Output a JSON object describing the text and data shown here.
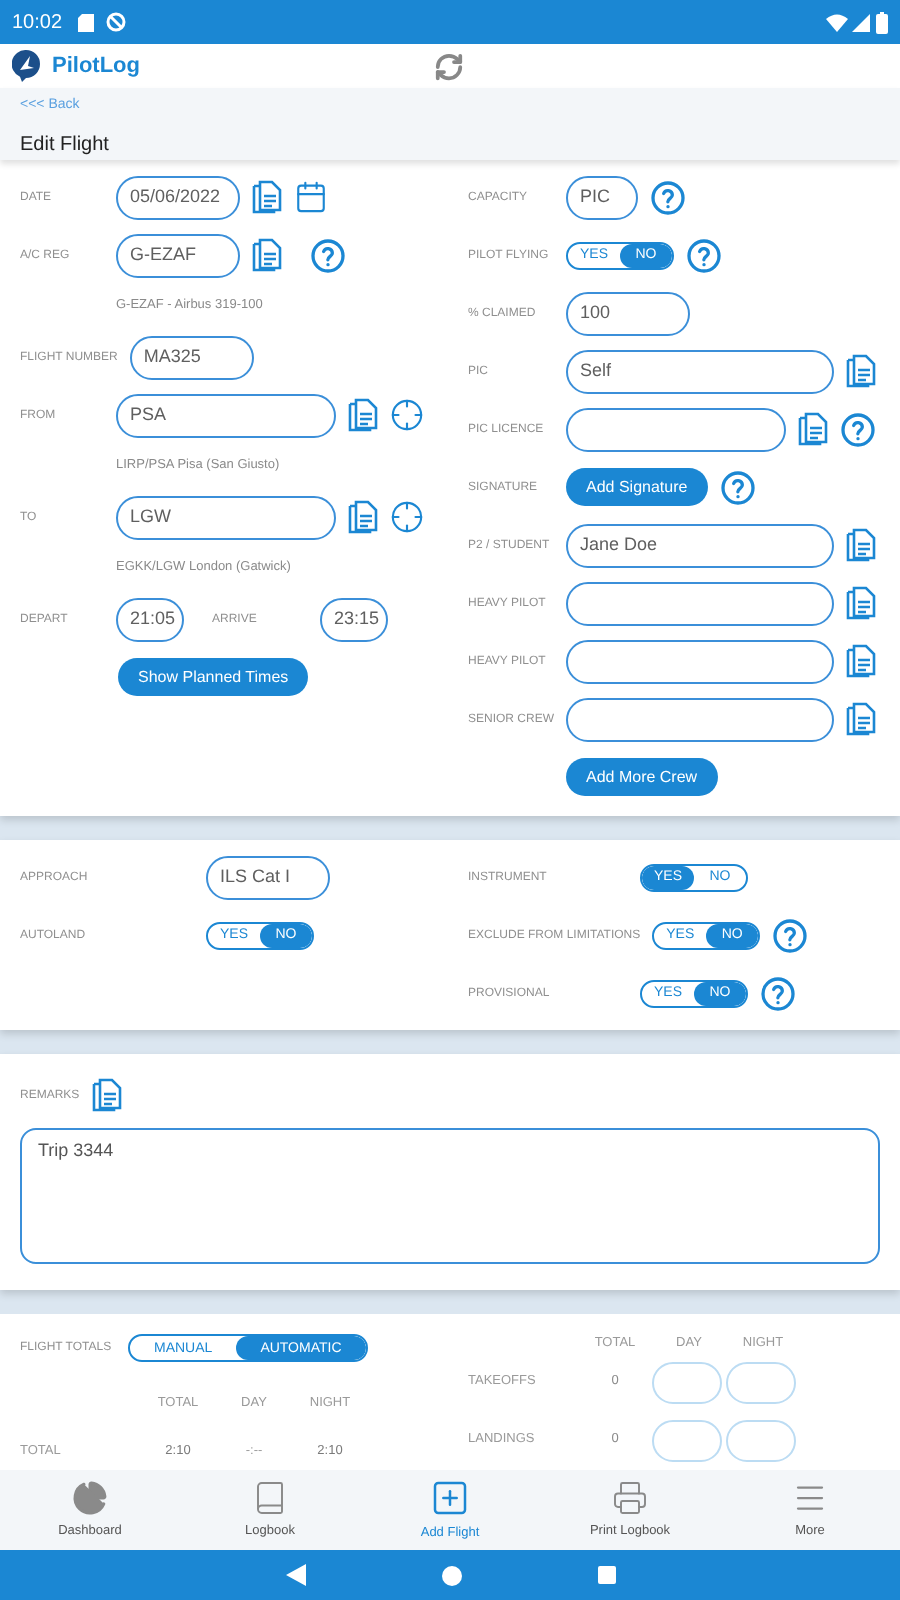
{
  "status_bar": {
    "time": "10:02"
  },
  "app": {
    "name": "PilotLog"
  },
  "back_link": "<<< Back",
  "page_title": "Edit Flight",
  "flight": {
    "left": [
      {
        "kind": "date",
        "label": "DATE",
        "value": "05/06/2022"
      },
      {
        "kind": "reg",
        "label": "A/C REG",
        "value": "G-EZAF",
        "note": "G-EZAF - Airbus 319-100"
      },
      {
        "kind": "short",
        "label": "FLIGHT NUMBER",
        "value": "MA325"
      },
      {
        "kind": "place",
        "label": "FROM",
        "value": "PSA",
        "note": "LIRP/PSA Pisa (San Giusto)"
      },
      {
        "kind": "place",
        "label": "TO",
        "value": "LGW",
        "note": "EGKK/LGW London (Gatwick)"
      },
      {
        "kind": "times",
        "label": "DEPART",
        "value": "21:05",
        "label2": "ARRIVE",
        "value2": "23:15"
      },
      {
        "kind": "button",
        "label": "Show Planned Times"
      }
    ],
    "right": [
      {
        "kind": "short_help",
        "label": "CAPACITY",
        "value": "PIC"
      },
      {
        "kind": "toggle_help",
        "label": "PILOT FLYING",
        "options": [
          {
            "label": "YES",
            "selected": false
          },
          {
            "label": "NO",
            "selected": true
          }
        ]
      },
      {
        "kind": "short",
        "label": "% CLAIMED",
        "value": "100"
      },
      {
        "kind": "wide",
        "label": "PIC",
        "value": "Self"
      },
      {
        "kind": "wide_help",
        "label": "PIC LICENCE"
      },
      {
        "kind": "button_help",
        "label": "SIGNATURE",
        "button": "Add Signature"
      },
      {
        "kind": "wide",
        "label": "P2 / STUDENT",
        "value": "Jane Doe"
      },
      {
        "kind": "wide",
        "label": "HEAVY PILOT"
      },
      {
        "kind": "wide",
        "label": "HEAVY PILOT"
      },
      {
        "kind": "wide",
        "label": "SENIOR CREW"
      },
      {
        "kind": "button",
        "label": "Add More Crew"
      }
    ]
  },
  "conditions": {
    "left": [
      {
        "kind": "short",
        "label": "APPROACH",
        "value": "ILS Cat I"
      },
      {
        "kind": "toggle",
        "label": "AUTOLAND",
        "options": [
          {
            "label": "YES",
            "selected": false
          },
          {
            "label": "NO",
            "selected": true
          }
        ]
      }
    ],
    "right": [
      {
        "kind": "toggle",
        "label": "INSTRUMENT",
        "options": [
          {
            "label": "YES",
            "selected": true
          },
          {
            "label": "NO",
            "selected": false
          }
        ]
      },
      {
        "kind": "toggle_help",
        "label": "EXCLUDE FROM LIMITATIONS",
        "options": [
          {
            "label": "YES",
            "selected": false
          },
          {
            "label": "NO",
            "selected": true
          }
        ]
      },
      {
        "kind": "toggle_help",
        "label": "PROVISIONAL",
        "options": [
          {
            "label": "YES",
            "selected": false
          },
          {
            "label": "NO",
            "selected": true
          }
        ]
      }
    ]
  },
  "remarks": {
    "label": "REMARKS",
    "value": "Trip 3344"
  },
  "totals": {
    "label": "FLIGHT TOTALS",
    "modes": [
      {
        "label": "MANUAL",
        "selected": false
      },
      {
        "label": "AUTOMATIC",
        "selected": true
      }
    ],
    "columns": [
      "TOTAL",
      "DAY",
      "NIGHT"
    ],
    "rows": [
      {
        "label": "TOTAL",
        "values": [
          "2:10",
          "-:--",
          "2:10"
        ]
      }
    ],
    "counts_columns": [
      "TOTAL",
      "DAY",
      "NIGHT"
    ],
    "counts": [
      {
        "label": "TAKEOFFS",
        "total": "0"
      },
      {
        "label": "LANDINGS",
        "total": "0"
      }
    ]
  },
  "nav": [
    {
      "kind": "dashboard",
      "label": "Dashboard",
      "selected": false
    },
    {
      "kind": "logbook",
      "label": "Logbook",
      "selected": false
    },
    {
      "kind": "add",
      "label": "Add Flight",
      "selected": true
    },
    {
      "kind": "print",
      "label": "Print Logbook",
      "selected": false
    },
    {
      "kind": "more",
      "label": "More",
      "selected": false
    }
  ]
}
